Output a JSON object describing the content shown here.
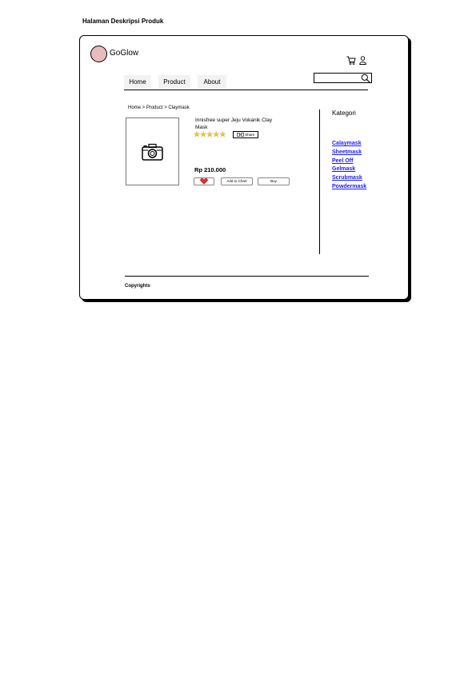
{
  "page": {
    "title": "Halaman Deskripsi Produk"
  },
  "header": {
    "logo_text": "GoGlow",
    "nav": [
      {
        "label": "Home"
      },
      {
        "label": "Product"
      },
      {
        "label": "About"
      }
    ],
    "search": {
      "value": "",
      "placeholder": ""
    },
    "icons": [
      "cart-icon",
      "user-icon",
      "search-icon"
    ]
  },
  "breadcrumb": "Home > Product > Claymask",
  "product": {
    "name": "Innisfree super Jeju Vokanik Clay Mask",
    "rating_stars": 5,
    "share_label": "Share",
    "price": "Rp 210.000",
    "buttons": {
      "add_to_cart": "Add to Chart",
      "buy": "Buy"
    },
    "image_icon": "camera-icon"
  },
  "sidebar": {
    "title": "Kategori",
    "items": [
      {
        "label": "Calaymask"
      },
      {
        "label": "Sheetmask"
      },
      {
        "label": "Peel Off"
      },
      {
        "label": "Gelmask"
      },
      {
        "label": "Scrubmask"
      },
      {
        "label": "Powdermask"
      }
    ]
  },
  "footer": {
    "text": "Copyrights"
  },
  "colors": {
    "link": "#1a1aff",
    "logo": "#e8bcbc",
    "star": "#f5cb2e",
    "heart": "#e03030"
  }
}
